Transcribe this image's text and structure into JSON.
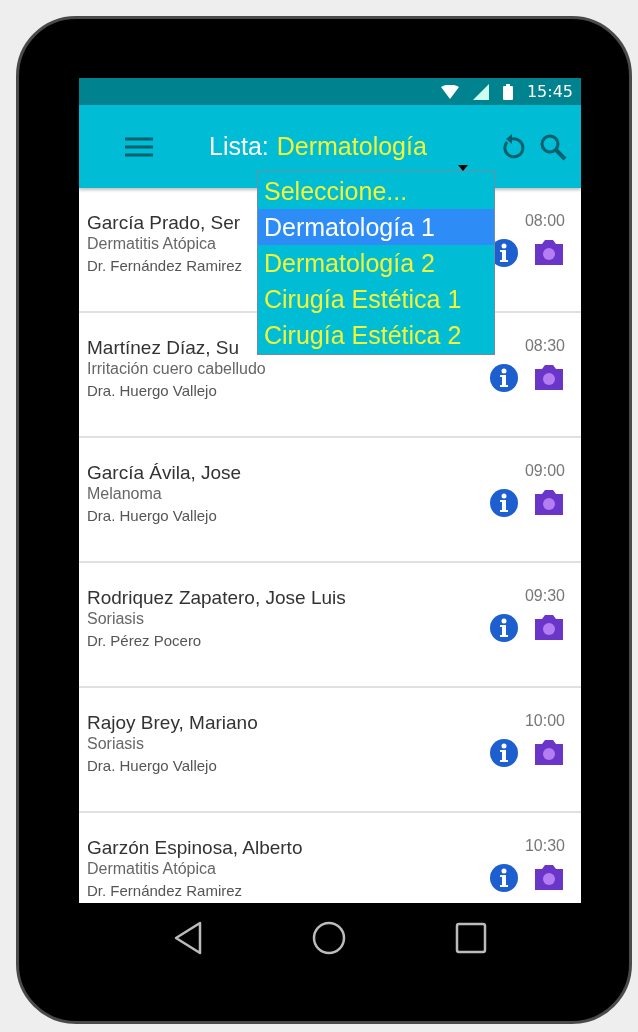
{
  "status_bar": {
    "time": "15:45"
  },
  "app_bar": {
    "label": "Lista:",
    "value": "Dermatología"
  },
  "dropdown": {
    "options": [
      {
        "label": "Seleccione...",
        "selected": false
      },
      {
        "label": "Dermatología 1",
        "selected": true
      },
      {
        "label": "Dermatología 2",
        "selected": false
      },
      {
        "label": "Cirugía Estética 1",
        "selected": false
      },
      {
        "label": "Cirugía Estética 2",
        "selected": false
      }
    ]
  },
  "appointments": [
    {
      "name": "García Prado, Ser",
      "diagnosis": "Dermatitis Atópica",
      "doctor": "Dr. Fernández Ramirez",
      "time": "08:00"
    },
    {
      "name": "Martínez Díaz, Su",
      "diagnosis": "Irritación cuero cabelludo",
      "doctor": "Dra. Huergo Vallejo",
      "time": "08:30"
    },
    {
      "name": "García Ávila, Jose",
      "diagnosis": "Melanoma",
      "doctor": "Dra. Huergo Vallejo",
      "time": "09:00"
    },
    {
      "name": "Rodriquez Zapatero, Jose Luis",
      "diagnosis": "Soriasis",
      "doctor": "Dr. Pérez Pocero",
      "time": "09:30"
    },
    {
      "name": "Rajoy Brey, Mariano",
      "diagnosis": "Soriasis",
      "doctor": "Dra. Huergo Vallejo",
      "time": "10:00"
    },
    {
      "name": "Garzón Espinosa, Alberto",
      "diagnosis": "Dermatitis Atópica",
      "doctor": "Dr. Fernández Ramirez",
      "time": "10:30"
    }
  ]
}
